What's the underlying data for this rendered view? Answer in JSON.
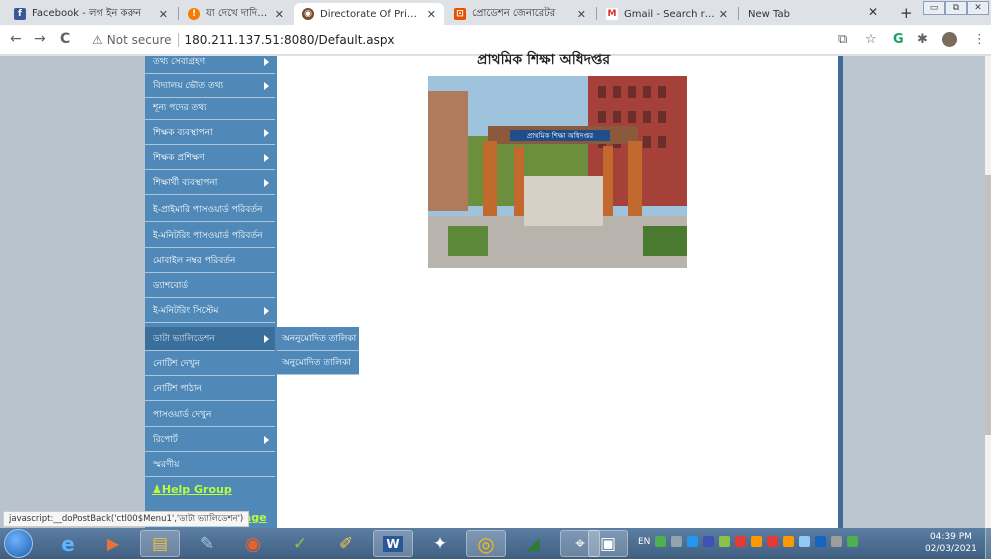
{
  "browser": {
    "tabs": [
      {
        "title": "Facebook - লগ ইন করুন",
        "favicon_color": "#3b5998",
        "favicon_glyph": "f"
      },
      {
        "title": "যা দেখে দাদিদের চেনে গাড়",
        "favicon_color": "#f57c00",
        "favicon_glyph": "!"
      },
      {
        "title": "Directorate Of Primary",
        "favicon_color": "#7a4b2a",
        "favicon_glyph": "◉"
      },
      {
        "title": "প্রোডেশন জেনারেটর",
        "favicon_color": "#e65100",
        "favicon_glyph": "⊡"
      },
      {
        "title": "Gmail - Search results",
        "favicon_color": "#d93025",
        "favicon_glyph": "M"
      },
      {
        "title": "New Tab",
        "favicon_color": "#dee1e6",
        "favicon_glyph": ""
      }
    ],
    "close_glyph": "✕",
    "new_tab_glyph": "+",
    "win_controls": [
      "▭",
      "⧉",
      "✕"
    ],
    "back_icon": "←",
    "forward_icon": "→",
    "reload_icon": "C",
    "security_icon": "⚠",
    "security_label": "Not secure",
    "url": "180.211.137.51:8080/Default.aspx",
    "toolbar_icons": [
      "⧉",
      "☆",
      "G",
      "✱",
      "",
      "⋮"
    ]
  },
  "page": {
    "content_title": "প্রাথমিক শিক্ষা অধিদপ্তর",
    "menu": [
      {
        "label": "তথ্য সেবাগ্রহণ",
        "submenu": true
      },
      {
        "label": "বিদ্যালয় ভৌত তথ্য",
        "submenu": true
      },
      {
        "label": "শূন্য পদের তথ্য",
        "submenu": false
      },
      {
        "label": "শিক্ষক ব্যবস্থাপনা",
        "submenu": true
      },
      {
        "label": "শিক্ষক প্রশিক্ষণ",
        "submenu": true
      },
      {
        "label": "শিক্ষার্থী ব্যবস্থাপনা",
        "submenu": true
      },
      {
        "label": "ই-প্রাইমারি পাসওয়ার্ড পরিবর্তন",
        "submenu": false
      },
      {
        "label": "ই-মনিটরিং পাসওয়ার্ড পরিবর্তন",
        "submenu": false
      },
      {
        "label": "মোবাইল নম্বর পরিবর্তন",
        "submenu": false
      },
      {
        "label": "ড্যাশবোর্ড",
        "submenu": false
      },
      {
        "label": "ই-মনিটরিং সিস্টেম",
        "submenu": true
      },
      {
        "label": "ডাটা ভ্যালিডেশন",
        "submenu": true,
        "highlighted": true
      },
      {
        "label": "নোটিশ দেখুন",
        "submenu": false
      },
      {
        "label": "নোটিশ পাঠান",
        "submenu": false
      },
      {
        "label": "পাসওয়ার্ড দেখুন",
        "submenu": false
      },
      {
        "label": "রিপোর্ট",
        "submenu": true
      },
      {
        "label": "স্মরণীয়",
        "submenu": false
      }
    ],
    "submenu_items": [
      "অননুমোদিত তালিকা",
      "অনুমোদিত তালিকা"
    ],
    "help_group": "Help Group",
    "page_link": "Page",
    "status_text": "javascript:__doPostBack('ctl00$Menu1','ডাটা ভ্যালিডেশন')",
    "photo_caption": "প্রাথমিক শিক্ষা অধিদপ্তর"
  },
  "taskbar": {
    "apps": [
      {
        "name": "internet-explorer",
        "glyph": "e",
        "color": "#3a8de0"
      },
      {
        "name": "media-player",
        "glyph": "▶",
        "color": "#e8733a"
      },
      {
        "name": "file-explorer",
        "glyph": "▤",
        "color": "#f0c040"
      },
      {
        "name": "paint",
        "glyph": "✎",
        "color": "#7ab"
      },
      {
        "name": "firefox",
        "glyph": "◉",
        "color": "#e8622a"
      },
      {
        "name": "word-art",
        "glyph": "✓",
        "color": "#8bc34a"
      },
      {
        "name": "pen-tool",
        "glyph": "✐",
        "color": "#c9a227"
      },
      {
        "name": "word",
        "glyph": "W",
        "color": "#2b579a"
      },
      {
        "name": "media-app",
        "glyph": "✦",
        "color": "#222"
      },
      {
        "name": "chrome",
        "glyph": "◎",
        "color": "#e53935"
      },
      {
        "name": "vpn-app",
        "glyph": "◢",
        "color": "#1565c0"
      },
      {
        "name": "mouse-app",
        "glyph": "⌖",
        "color": "#5a7fa8"
      },
      {
        "name": "window-app",
        "glyph": "▣",
        "color": "#5a7fa8"
      }
    ],
    "tray_lang": "EN",
    "tray_icon_colors": [
      "#4caf50",
      "#90a4ae",
      "#2196f3",
      "#3f51b5",
      "#8bc34a",
      "#e53935",
      "#ff9800",
      "#e53935",
      "#ff9800",
      "#90caf9",
      "#1565c0",
      "#9e9e9e",
      "#4caf50"
    ],
    "time": "04:39 PM",
    "date": "02/03/2021"
  }
}
